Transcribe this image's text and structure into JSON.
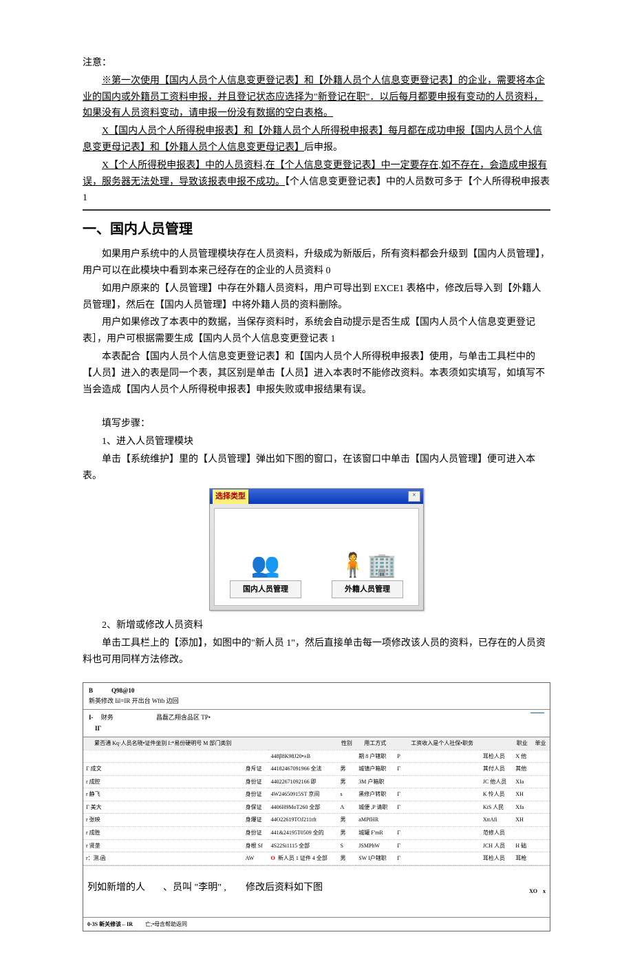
{
  "notice_heading": "注意：",
  "notice_p1": "※第一次使用【国内人员个人信息变更登记表】和【外籍人员个人信息变更登记表】的企业，需要将本企业的国内或外籍员工资料申报，并且登记状态应选择为\"新登记在职\"．以后每月都要申报有变动的人员资料，如果没有人员资料变动，请申报一份没有数据的空白表格。",
  "notice_p2a": "X【国内人员个人所得税申报表】和【外籍人员个人所得税申报表】每月都在成功申报【国内人员个人信息变更母记表】和【外籍人员个人信息变更母记表】",
  "notice_p2b": "后申报。",
  "notice_p3a": "X【个人所得税申报表】中的人员资料,在【个人信息变更登记表】中一定要存在,如不存在，会造成申报有误，服务器无法处理，导致该报表申报不成功。",
  "notice_p3b": "【个人信息变更登记表】中的人员数可多于【个人所得税申报表 1",
  "section_title": "一、国内人员管理",
  "sec_p1": "如果用户系统中的人员管理模块存在人员资料，升级成为新版后，所有资料都会升级到【国内人员管理】，用户可以在此模块中看到本来己经存在的企业的人员资料 0",
  "sec_p2": "如用户原来的【人员管理】中存在外籍人员资料，用户可导出到 EXCE1 表格中，修改后导入到【外籍人员管理】，然后在【国内人员管理】中将外籍人员的资料删除。",
  "sec_p3": "用户如果修改了本表中的数据，当保存资料时，系统会自动提示是否生成【国内人员个人信息变更登记表］，用户可根据需要生成【国内人员个人信息变更登记表 1",
  "sec_p4": "本表配合【国内人员个人信息变更登记表】和【国内人员个人所得税申报表】使用，与单击工具栏中的【人员】进入的表是同一个表，其区别是单击【人员】进入本表时不能修改资料。本表须如实填写，如填写不当会造成【国内人员个人所得税申报表】申报失败或申报结果有误。",
  "steps_heading": "填写步骤：",
  "step1_title": "1、进入人员管理模块",
  "step1_text": "单击【系统维护】里的【人员管理】弹出如下图的窗口，在该窗口中单击【国内人员管理】便可进入本表。",
  "dialog": {
    "title": "选择类型",
    "close": "×",
    "item1_label": "国内人员管理",
    "item2_label": "外籍人员管理"
  },
  "step2_title": "2、新增或修改人员资料",
  "step2_text": "单击工具栏上的【添加】，如图中的\"新人员 1\"，然后直接单击每一项修改该人员的资料，已存在的人员资料也可用同样方法修改。",
  "fig": {
    "top1": "B　　　Q98@10",
    "top2": "新英修改 Iil=IR 开出台 Wftb 边回",
    "bar2a": "I-",
    "bar2b": "财务",
    "bar2c": "昌磊乙翔含品区 TP•",
    "bar2d": "IΓ",
    "headers": [
      "累否通 Kq·人员名晓•证件坐别  I:*易份硬明号 M 部门类别",
      "",
      "",
      "性别",
      "用工方式",
      "",
      "工资收入是个人社保•职务",
      "",
      "职业",
      "单业"
    ],
    "rows": [
      [
        "",
        "",
        "448β8K98J20•±B",
        "",
        "期 8 户辖职",
        "P",
        "",
        "耳检人员",
        "X 他",
        ""
      ],
      [
        "Γ 成文",
        "身斥证",
        "44182467091966 全法",
        "男",
        "城镇户箱职",
        "Γ",
        "",
        "其付人员",
        "其他",
        ""
      ],
      [
        "r 成腔",
        "身份证",
        "44022671092166 即",
        "男",
        "3M 户箱职",
        "",
        "",
        "JC 他人员",
        "XIa",
        ""
      ],
      [
        "r 静飞",
        "身份证",
        "4W24650915ST 京间",
        "s",
        "黑修户转职",
        "Γ",
        "",
        "K 怜人员",
        "XH",
        ""
      ],
      [
        "Γ 美大",
        "身保证",
        "4406H9MoT260 全部",
        "Λ",
        "城便 ,P 请职",
        "Γ",
        "",
        "KiS 人民",
        "Xfa",
        ""
      ],
      [
        "r 张映",
        "身爆证",
        "44O22619TOJ211tft",
        "男",
        "aMPfHR",
        "",
        "",
        "XttAfi",
        "XH",
        ""
      ],
      [
        "r 成胜",
        "身份证",
        "441&24195T0509 全的",
        "男",
        "城罐 F'mR",
        "Γ",
        "",
        "范修人员",
        "",
        ""
      ],
      [
        "r 贤垄",
        "身根 Sf",
        "4S22Si1115 全部",
        "S",
        "JSMPhW",
        "Γ",
        "",
        "JCH 人员",
        "H 础",
        ""
      ],
      [
        "r：测.函",
        "AW",
        "新人员 1 证件 4 全部",
        "男",
        "SW I户辖职",
        "Γ",
        "",
        "耳检人员",
        "耳枪",
        ""
      ]
    ],
    "note_left": "列如新增的人",
    "note_mid": "、员叫 \"李明\" ,",
    "note_right": "修改后资料如下图",
    "note_far_right": "XO　x",
    "footer_left": "0-3S 新关修该←IR",
    "footer_mid": "亡;•母含帮助返同"
  }
}
